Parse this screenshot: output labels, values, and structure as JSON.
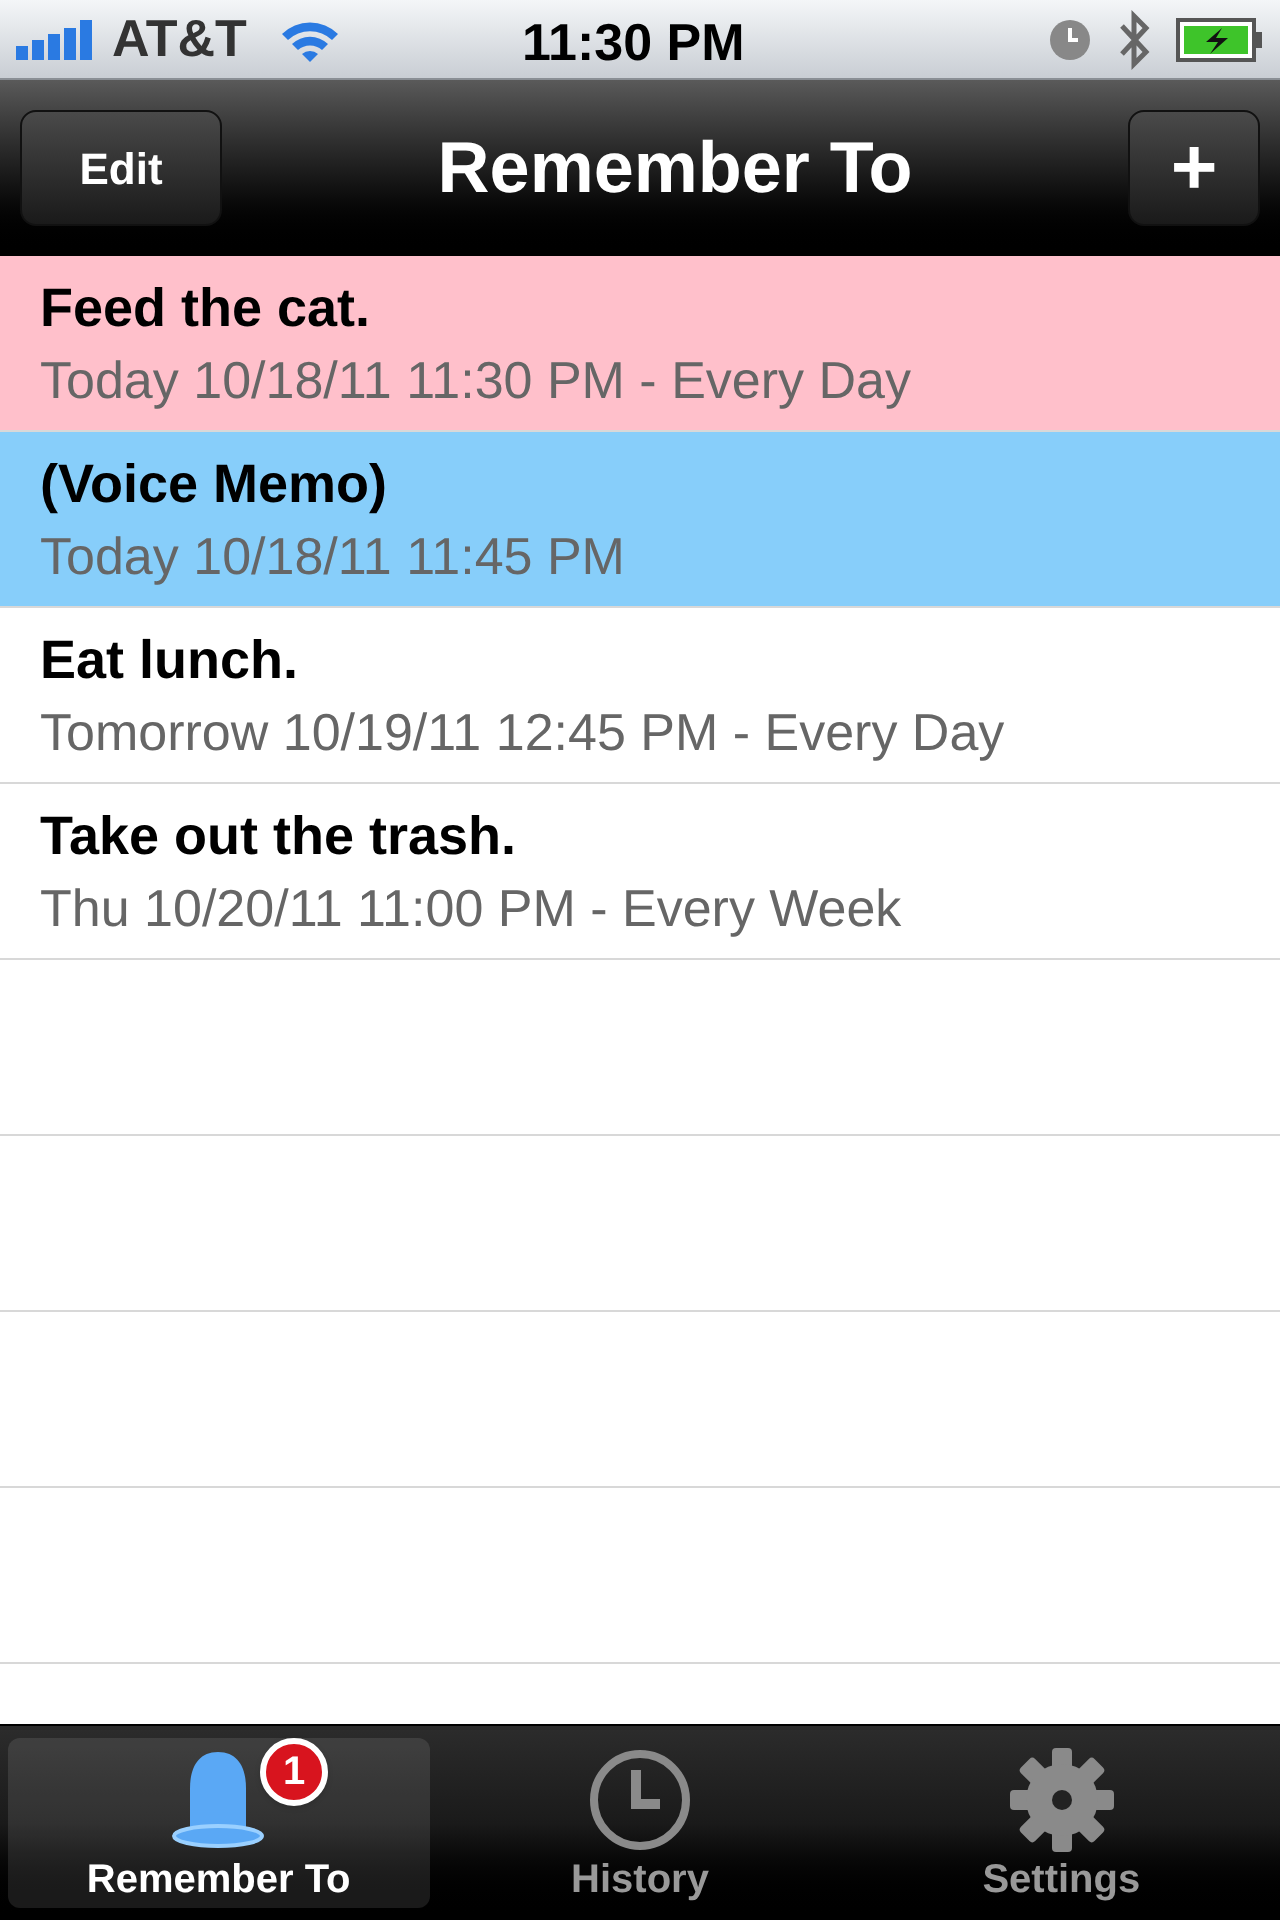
{
  "status_bar": {
    "carrier": "AT&T",
    "time": "11:30 PM"
  },
  "nav_bar": {
    "title": "Remember To",
    "left_button": "Edit",
    "right_button": "+"
  },
  "reminders": [
    {
      "title": "Feed the cat.",
      "detail": "Today 10/18/11 11:30 PM - Every Day",
      "color": "#ffc0cb"
    },
    {
      "title": "(Voice Memo)",
      "detail": "Today 10/18/11 11:45 PM",
      "color": "#87cefa"
    },
    {
      "title": "Eat lunch.",
      "detail": "Tomorrow 10/19/11 12:45 PM - Every Day",
      "color": "#ffffff"
    },
    {
      "title": "Take out the trash.",
      "detail": "Thu 10/20/11 11:00 PM - Every Week",
      "color": "#ffffff"
    }
  ],
  "tabs": [
    {
      "label": "Remember To",
      "kind": "bell",
      "selected": true,
      "badge": "1"
    },
    {
      "label": "History",
      "kind": "clock",
      "selected": false
    },
    {
      "label": "Settings",
      "kind": "gear",
      "selected": false
    }
  ]
}
